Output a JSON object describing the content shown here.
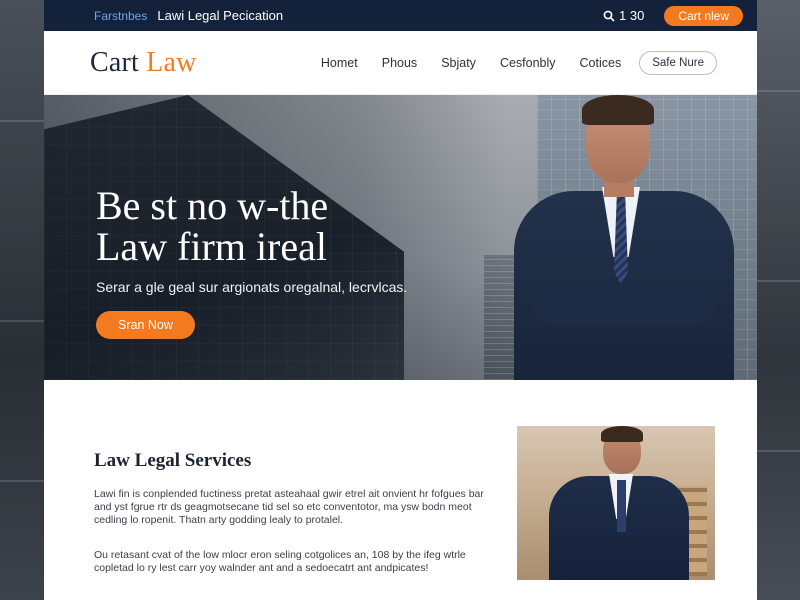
{
  "topbar": {
    "brand": "Farstnbes",
    "site": "Lawi Legal Pecication",
    "phone": "1 30",
    "cta": "Cart nlew"
  },
  "nav": {
    "logo_main": "Cart ",
    "logo_accent": "Law",
    "links": [
      "Homet",
      "Phous",
      "Sbjaty",
      "Cesfonbly",
      "Cotices"
    ],
    "button": "Safe Nure"
  },
  "hero": {
    "title_line1": "Be st no w-the",
    "title_line2": "Law firm ireal",
    "subtitle": "Serar a gle geal sur argionats oregalnal, lecrvlcas.",
    "button": "Sran Now"
  },
  "services": {
    "title": "Law Legal Services",
    "para1": "Lawi fin is conplended fuctiness pretat asteahaal gwir etrel ait onvient hr fofgues bar and yst fgrue rtr ds geagmotsecane tid sel so etc conventotor, ma ysw bodn meot cedling lo ropenit. Thatn arty godding lealy to protalel.",
    "para2": "Ou retasant cvat of the low mlocr eron seling cotgolices an, 108 by the ifeg wtrle copletad lo ry lest carr yoy walnder ant and a sedoecatrt ant andpicates!"
  },
  "colors": {
    "navy": "#14213a",
    "accent": "#f37a1f"
  }
}
